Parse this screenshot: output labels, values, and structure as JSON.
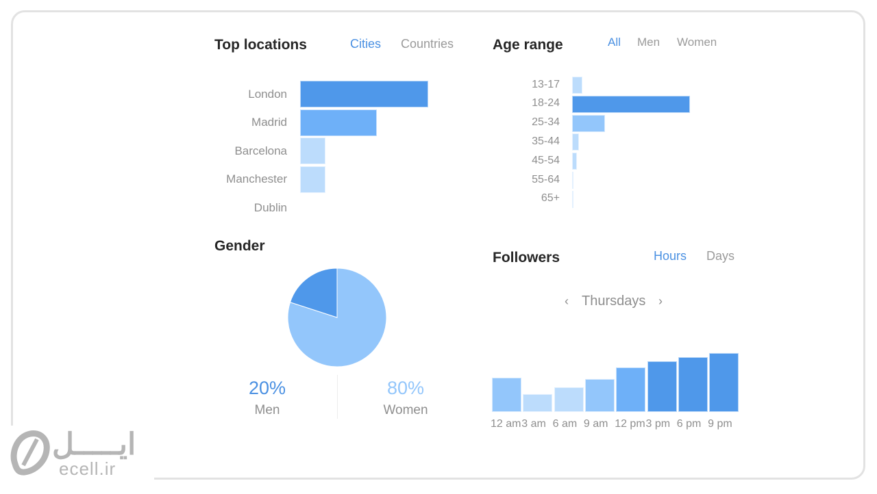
{
  "colors": {
    "accent": "#4a90e2",
    "dark_blue": "#4f98ea",
    "medium_blue": "#6eb0f8",
    "light_blue": "#93c6fb",
    "lightest_blue": "#bcdcfc",
    "muted_text": "#8e8e8e",
    "title_text": "#262626"
  },
  "top_locations": {
    "title": "Top locations",
    "tabs": [
      {
        "label": "Cities",
        "active": true
      },
      {
        "label": "Countries",
        "active": false
      }
    ]
  },
  "age_range": {
    "title": "Age range",
    "tabs": [
      {
        "label": "All",
        "active": true
      },
      {
        "label": "Men",
        "active": false
      },
      {
        "label": "Women",
        "active": false
      }
    ]
  },
  "gender": {
    "title": "Gender",
    "men": {
      "percent": "20%",
      "label": "Men"
    },
    "women": {
      "percent": "80%",
      "label": "Women"
    }
  },
  "followers": {
    "title": "Followers",
    "tabs": [
      {
        "label": "Hours",
        "active": true
      },
      {
        "label": "Days",
        "active": false
      }
    ],
    "day_selector": {
      "prev_icon": "chevron-left-icon",
      "label": "Thursdays",
      "next_icon": "chevron-right-icon"
    }
  },
  "watermark": {
    "text_fa": "ایـــــل",
    "text_en": "ecell.ir",
    "icon": "ecell-logo-icon"
  },
  "chart_data": [
    {
      "id": "top_locations",
      "type": "bar",
      "orientation": "horizontal",
      "title": "Top locations",
      "categories": [
        "London",
        "Madrid",
        "Barcelona",
        "Manchester",
        "Dublin"
      ],
      "values": [
        100,
        60,
        20,
        20,
        0
      ],
      "value_units": "relative share (max = 100)",
      "bar_colors": [
        "#4f98ea",
        "#6eb0f8",
        "#bcdcfc",
        "#bcdcfc",
        "#bcdcfc"
      ],
      "grid": false,
      "legend": "none"
    },
    {
      "id": "age_range",
      "type": "bar",
      "orientation": "horizontal",
      "title": "Age range",
      "categories": [
        "13-17",
        "18-24",
        "25-34",
        "35-44",
        "45-54",
        "55-64",
        "65+"
      ],
      "values": [
        9,
        100,
        28,
        6,
        4,
        1,
        1
      ],
      "value_units": "relative share (max = 100)",
      "bar_colors": [
        "#bcdcfc",
        "#4f98ea",
        "#93c6fb",
        "#bcdcfc",
        "#bcdcfc",
        "#bcdcfc",
        "#bcdcfc"
      ],
      "grid": false,
      "legend": "none"
    },
    {
      "id": "gender",
      "type": "pie",
      "title": "Gender",
      "categories": [
        "Men",
        "Women"
      ],
      "values": [
        20,
        80
      ],
      "slice_colors": [
        "#4f98ea",
        "#93c6fb"
      ],
      "legend": "bottom"
    },
    {
      "id": "followers",
      "type": "bar",
      "orientation": "vertical",
      "title": "Followers",
      "categories": [
        "12 am",
        "3 am",
        "6 am",
        "9 am",
        "12 pm",
        "3 pm",
        "6 pm",
        "9 pm"
      ],
      "values": [
        58,
        30,
        42,
        56,
        76,
        86,
        93,
        100
      ],
      "value_units": "relative activity (max = 100)",
      "bar_colors": [
        "#93c6fb",
        "#bcdcfc",
        "#bcdcfc",
        "#93c6fb",
        "#6eb0f8",
        "#4f98ea",
        "#4f98ea",
        "#4f98ea"
      ],
      "grid": false,
      "legend": "none"
    }
  ]
}
